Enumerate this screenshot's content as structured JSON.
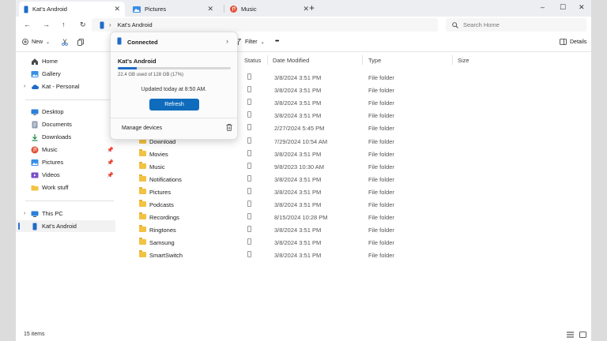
{
  "tabs": [
    {
      "label": "Kat's Android",
      "icon": "phone-icon",
      "active": true
    },
    {
      "label": "Pictures",
      "icon": "pictures-folder-icon",
      "active": false
    },
    {
      "label": "Music",
      "icon": "music-icon",
      "active": false
    }
  ],
  "new_tab_label": "+",
  "window_controls": {
    "minimize": "–",
    "maximize": "☐",
    "close": "✕"
  },
  "nav": {
    "back": "←",
    "forward": "→",
    "up": "↑",
    "refresh": "↻"
  },
  "address": {
    "crumb": "Kat's Android",
    "chevron": "›"
  },
  "search": {
    "placeholder": "Search Home"
  },
  "commands": {
    "new": "New",
    "filter": "Filter",
    "more": "•••",
    "details": "Details"
  },
  "sidebar": {
    "group1": [
      {
        "label": "Home",
        "icon": "home-icon"
      },
      {
        "label": "Gallery",
        "icon": "gallery-icon"
      },
      {
        "label": "Kat - Personal",
        "icon": "cloud-icon",
        "expandable": true
      }
    ],
    "group2": [
      {
        "label": "Desktop",
        "icon": "desktop-icon",
        "pinned": false
      },
      {
        "label": "Documents",
        "icon": "documents-icon",
        "pinned": false
      },
      {
        "label": "Downloads",
        "icon": "downloads-icon",
        "pinned": false
      },
      {
        "label": "Music",
        "icon": "music-icon",
        "pinned": true
      },
      {
        "label": "Pictures",
        "icon": "pictures-icon",
        "pinned": true
      },
      {
        "label": "Videos",
        "icon": "videos-icon",
        "pinned": true
      },
      {
        "label": "Work stuff",
        "icon": "folder-icon",
        "pinned": false
      }
    ],
    "group3": [
      {
        "label": "This PC",
        "icon": "this-pc-icon",
        "expandable": true,
        "selected": false
      },
      {
        "label": "Kat's Android",
        "icon": "phone-icon",
        "expandable": false,
        "selected": true
      }
    ]
  },
  "columns": {
    "status": "Status",
    "date_modified": "Date Modified",
    "type": "Type",
    "size": "Size"
  },
  "files": [
    {
      "name": "",
      "date": "3/8/2024 3:51 PM",
      "type": "File folder"
    },
    {
      "name": "",
      "date": "3/8/2024 3:51 PM",
      "type": "File folder"
    },
    {
      "name": "",
      "date": "3/8/2024 3:51 PM",
      "type": "File folder"
    },
    {
      "name": "",
      "date": "3/8/2024 3:51 PM",
      "type": "File folder"
    },
    {
      "name": "",
      "date": "2/27/2024 5:45 PM",
      "type": "File folder"
    },
    {
      "name": "Download",
      "date": "7/29/2024 10:54 AM",
      "type": "File folder"
    },
    {
      "name": "Movies",
      "date": "3/8/2024 3:51 PM",
      "type": "File folder"
    },
    {
      "name": "Music",
      "date": "9/8/2023 10:30 AM",
      "type": "File folder"
    },
    {
      "name": "Notifications",
      "date": "3/8/2024 3:51 PM",
      "type": "File folder"
    },
    {
      "name": "Pictures",
      "date": "3/8/2024 3:51 PM",
      "type": "File folder"
    },
    {
      "name": "Podcasts",
      "date": "3/8/2024 3:51 PM",
      "type": "File folder"
    },
    {
      "name": "Recordings",
      "date": "8/15/2024 10:28 PM",
      "type": "File folder"
    },
    {
      "name": "Ringtones",
      "date": "3/8/2024 3:51 PM",
      "type": "File folder"
    },
    {
      "name": "Samsung",
      "date": "3/8/2024 3:51 PM",
      "type": "File folder"
    },
    {
      "name": "SmartSwitch",
      "date": "3/8/2024 3:51 PM",
      "type": "File folder"
    }
  ],
  "flyout": {
    "title": "Connected",
    "device": "Kat's Android",
    "usage_text": "22.4 GB used of 128 GB (17%)",
    "usage_fraction": 0.17,
    "updated": "Updated today at 8:50 AM.",
    "refresh_label": "Refresh",
    "manage_label": "Manage devices"
  },
  "status_bar": {
    "count": "15 items"
  },
  "colors": {
    "accent": "#0f6cbd",
    "folder": "#f3c243"
  }
}
